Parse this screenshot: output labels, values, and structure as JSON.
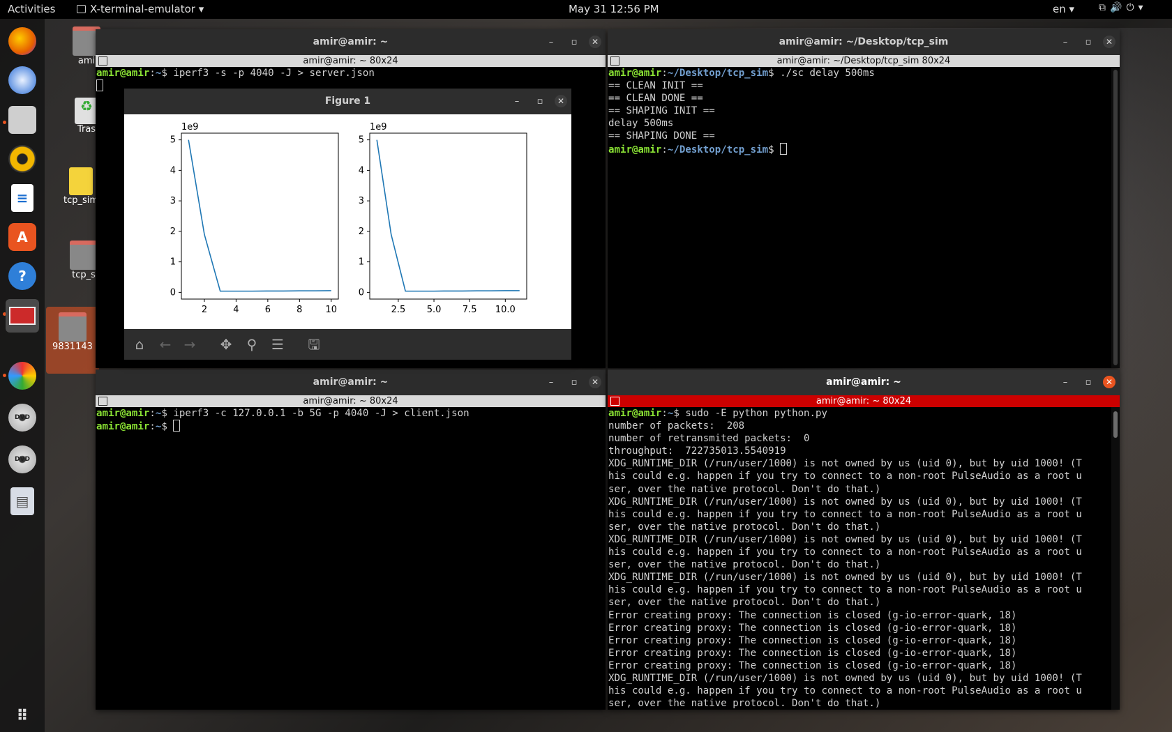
{
  "topbar": {
    "activities": "Activities",
    "app_name": "X-terminal-emulator",
    "clock": "May 31  12:56 PM",
    "lang": "en"
  },
  "dock": {
    "items": [
      "firefox-icon",
      "thunderbird-icon",
      "files-icon",
      "rhythmbox-icon",
      "writer-icon",
      "software-center-icon",
      "help-icon",
      "terminal-icon",
      "pinwheel-app-icon",
      "dvd-icon",
      "dvd-icon",
      "text-editor-icon",
      "apps-grid-icon"
    ]
  },
  "desktop": {
    "icons": [
      {
        "label": "ami"
      },
      {
        "label": "Tras"
      },
      {
        "label": "tcp_sim"
      },
      {
        "label": "tcp_s"
      },
      {
        "label": "9831143"
      }
    ]
  },
  "windows": {
    "top_left": {
      "title": "amir@amir: ~",
      "subtitle": "amir@amir: ~ 80x24",
      "line1_user": "amir@amir",
      "line1_path": "~",
      "line1_cmd": "$ iperf3 -s -p 4040 -J > server.json"
    },
    "top_right": {
      "title": "amir@amir: ~/Desktop/tcp_sim",
      "subtitle": "amir@amir: ~/Desktop/tcp_sim 80x24",
      "prompt_user": "amir@amir",
      "prompt_path": "~/Desktop/tcp_sim",
      "cmd": "$ ./sc delay 500ms",
      "output": [
        "== CLEAN INIT ==",
        "== CLEAN DONE ==",
        "== SHAPING INIT ==",
        "delay 500ms",
        "== SHAPING DONE =="
      ],
      "prompt_end": "$ "
    },
    "bottom_left": {
      "title": "amir@amir: ~",
      "subtitle": "amir@amir: ~ 80x24",
      "prompt_user": "amir@amir",
      "prompt_path": "~",
      "cmd": "$ iperf3 -c 127.0.0.1 -b 5G -p 4040 -J > client.json",
      "prompt_end": "$ "
    },
    "bottom_right": {
      "title": "amir@amir: ~",
      "subtitle": "amir@amir: ~ 80x24",
      "prompt_user": "amir@amir",
      "prompt_path": "~",
      "cmd": "$ sudo -E python python.py",
      "output": [
        "number of packets:  208",
        "number of retransmited packets:  0",
        "throughput:  722735013.5540919",
        "XDG_RUNTIME_DIR (/run/user/1000) is not owned by us (uid 0), but by uid 1000! (T",
        "his could e.g. happen if you try to connect to a non-root PulseAudio as a root u",
        "ser, over the native protocol. Don't do that.)",
        "XDG_RUNTIME_DIR (/run/user/1000) is not owned by us (uid 0), but by uid 1000! (T",
        "his could e.g. happen if you try to connect to a non-root PulseAudio as a root u",
        "ser, over the native protocol. Don't do that.)",
        "XDG_RUNTIME_DIR (/run/user/1000) is not owned by us (uid 0), but by uid 1000! (T",
        "his could e.g. happen if you try to connect to a non-root PulseAudio as a root u",
        "ser, over the native protocol. Don't do that.)",
        "XDG_RUNTIME_DIR (/run/user/1000) is not owned by us (uid 0), but by uid 1000! (T",
        "his could e.g. happen if you try to connect to a non-root PulseAudio as a root u",
        "ser, over the native protocol. Don't do that.)",
        "Error creating proxy: The connection is closed (g-io-error-quark, 18)",
        "Error creating proxy: The connection is closed (g-io-error-quark, 18)",
        "Error creating proxy: The connection is closed (g-io-error-quark, 18)",
        "Error creating proxy: The connection is closed (g-io-error-quark, 18)",
        "Error creating proxy: The connection is closed (g-io-error-quark, 18)",
        "XDG_RUNTIME_DIR (/run/user/1000) is not owned by us (uid 0), but by uid 1000! (T",
        "his could e.g. happen if you try to connect to a non-root PulseAudio as a root u",
        "ser, over the native protocol. Don't do that.)"
      ]
    }
  },
  "figure": {
    "title": "Figure 1",
    "colors": {
      "line": "#1f77b4"
    },
    "toolbar": [
      "home-icon",
      "back-icon",
      "forward-icon",
      "pan-icon",
      "zoom-icon",
      "configure-icon",
      "save-icon"
    ]
  },
  "chart_data": [
    {
      "type": "line",
      "offset_label": "1e9",
      "x": [
        1,
        2,
        3,
        4,
        5,
        6,
        7,
        8,
        9,
        10
      ],
      "series": [
        {
          "values": [
            5.0,
            1.9,
            0.04,
            0.04,
            0.04,
            0.045,
            0.045,
            0.05,
            0.05,
            0.055
          ]
        }
      ],
      "xlim": [
        0.55,
        10.45
      ],
      "ylim": [
        -0.22,
        5.22
      ],
      "xticks": [
        "2",
        "4",
        "6",
        "8",
        "10"
      ],
      "yticks": [
        "0",
        "1",
        "2",
        "3",
        "4",
        "5"
      ],
      "grid": false
    },
    {
      "type": "line",
      "offset_label": "1e9",
      "x": [
        1,
        2,
        3,
        4,
        5,
        6,
        7,
        8,
        9,
        10,
        11
      ],
      "series": [
        {
          "values": [
            5.0,
            1.9,
            0.04,
            0.04,
            0.04,
            0.045,
            0.045,
            0.05,
            0.05,
            0.055,
            0.055
          ]
        }
      ],
      "xlim": [
        0.5,
        11.5
      ],
      "ylim": [
        -0.22,
        5.22
      ],
      "xticks": [
        "2.5",
        "5.0",
        "7.5",
        "10.0"
      ],
      "yticks": [
        "0",
        "1",
        "2",
        "3",
        "4",
        "5"
      ],
      "grid": false
    }
  ]
}
